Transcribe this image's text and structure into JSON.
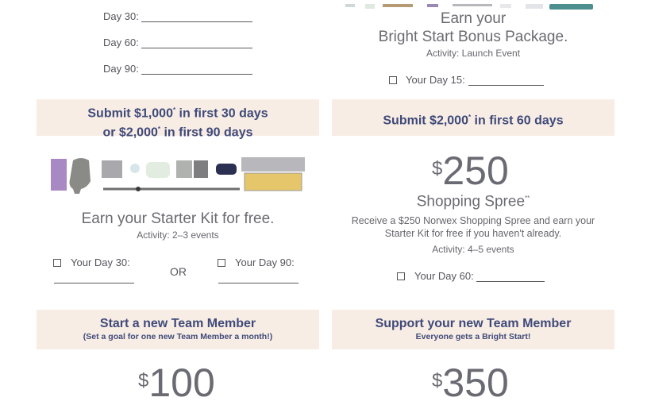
{
  "top_left": {
    "day30_label": "Day 30:",
    "day60_label": "Day 60:",
    "day90_label": "Day 90:"
  },
  "top_right": {
    "earn_line1": "Earn your",
    "earn_line2": "Bright Start Bonus Package.",
    "activity": "Activity: Launch Event",
    "day15_label": "Your Day 15:"
  },
  "starter_kit": {
    "banner_line1": "Submit $1,000",
    "banner_line1_end": " in first 30 days",
    "banner_line2": "or $2,000",
    "banner_line2_end": " in first 90 days",
    "asterisk": "*",
    "earn": "Earn your Starter Kit for free.",
    "activity": "Activity: 2–3 events",
    "day30_label": "Your Day 30:",
    "or": "OR",
    "day90_label": "Your Day 90:"
  },
  "shopping_spree": {
    "banner_text": "Submit $2,000",
    "banner_text_end": " in first 60 days",
    "asterisk": "*",
    "dollar": "$",
    "amount": "250",
    "title": "Shopping Spree",
    "title_mark": "**",
    "description_line1": "Receive a $250 Norwex Shopping Spree and earn your",
    "description_line2": "Starter Kit for free if you haven't already.",
    "activity": "Activity: 4–5 events",
    "day60_label": "Your Day 60:"
  },
  "team_member": {
    "banner_title": "Start a new Team Member",
    "banner_sub": "(Set a goal for one new Team Member a month!)",
    "dollar": "$",
    "amount": "100"
  },
  "support_member": {
    "banner_title": "Support your new Team Member",
    "banner_sub": "Everyone gets a Bright Start!",
    "dollar": "$",
    "amount": "350"
  },
  "colors": {
    "banner_bg": "#f8ede4",
    "banner_text": "#3f4a7a",
    "body_text": "#6a6a72"
  }
}
